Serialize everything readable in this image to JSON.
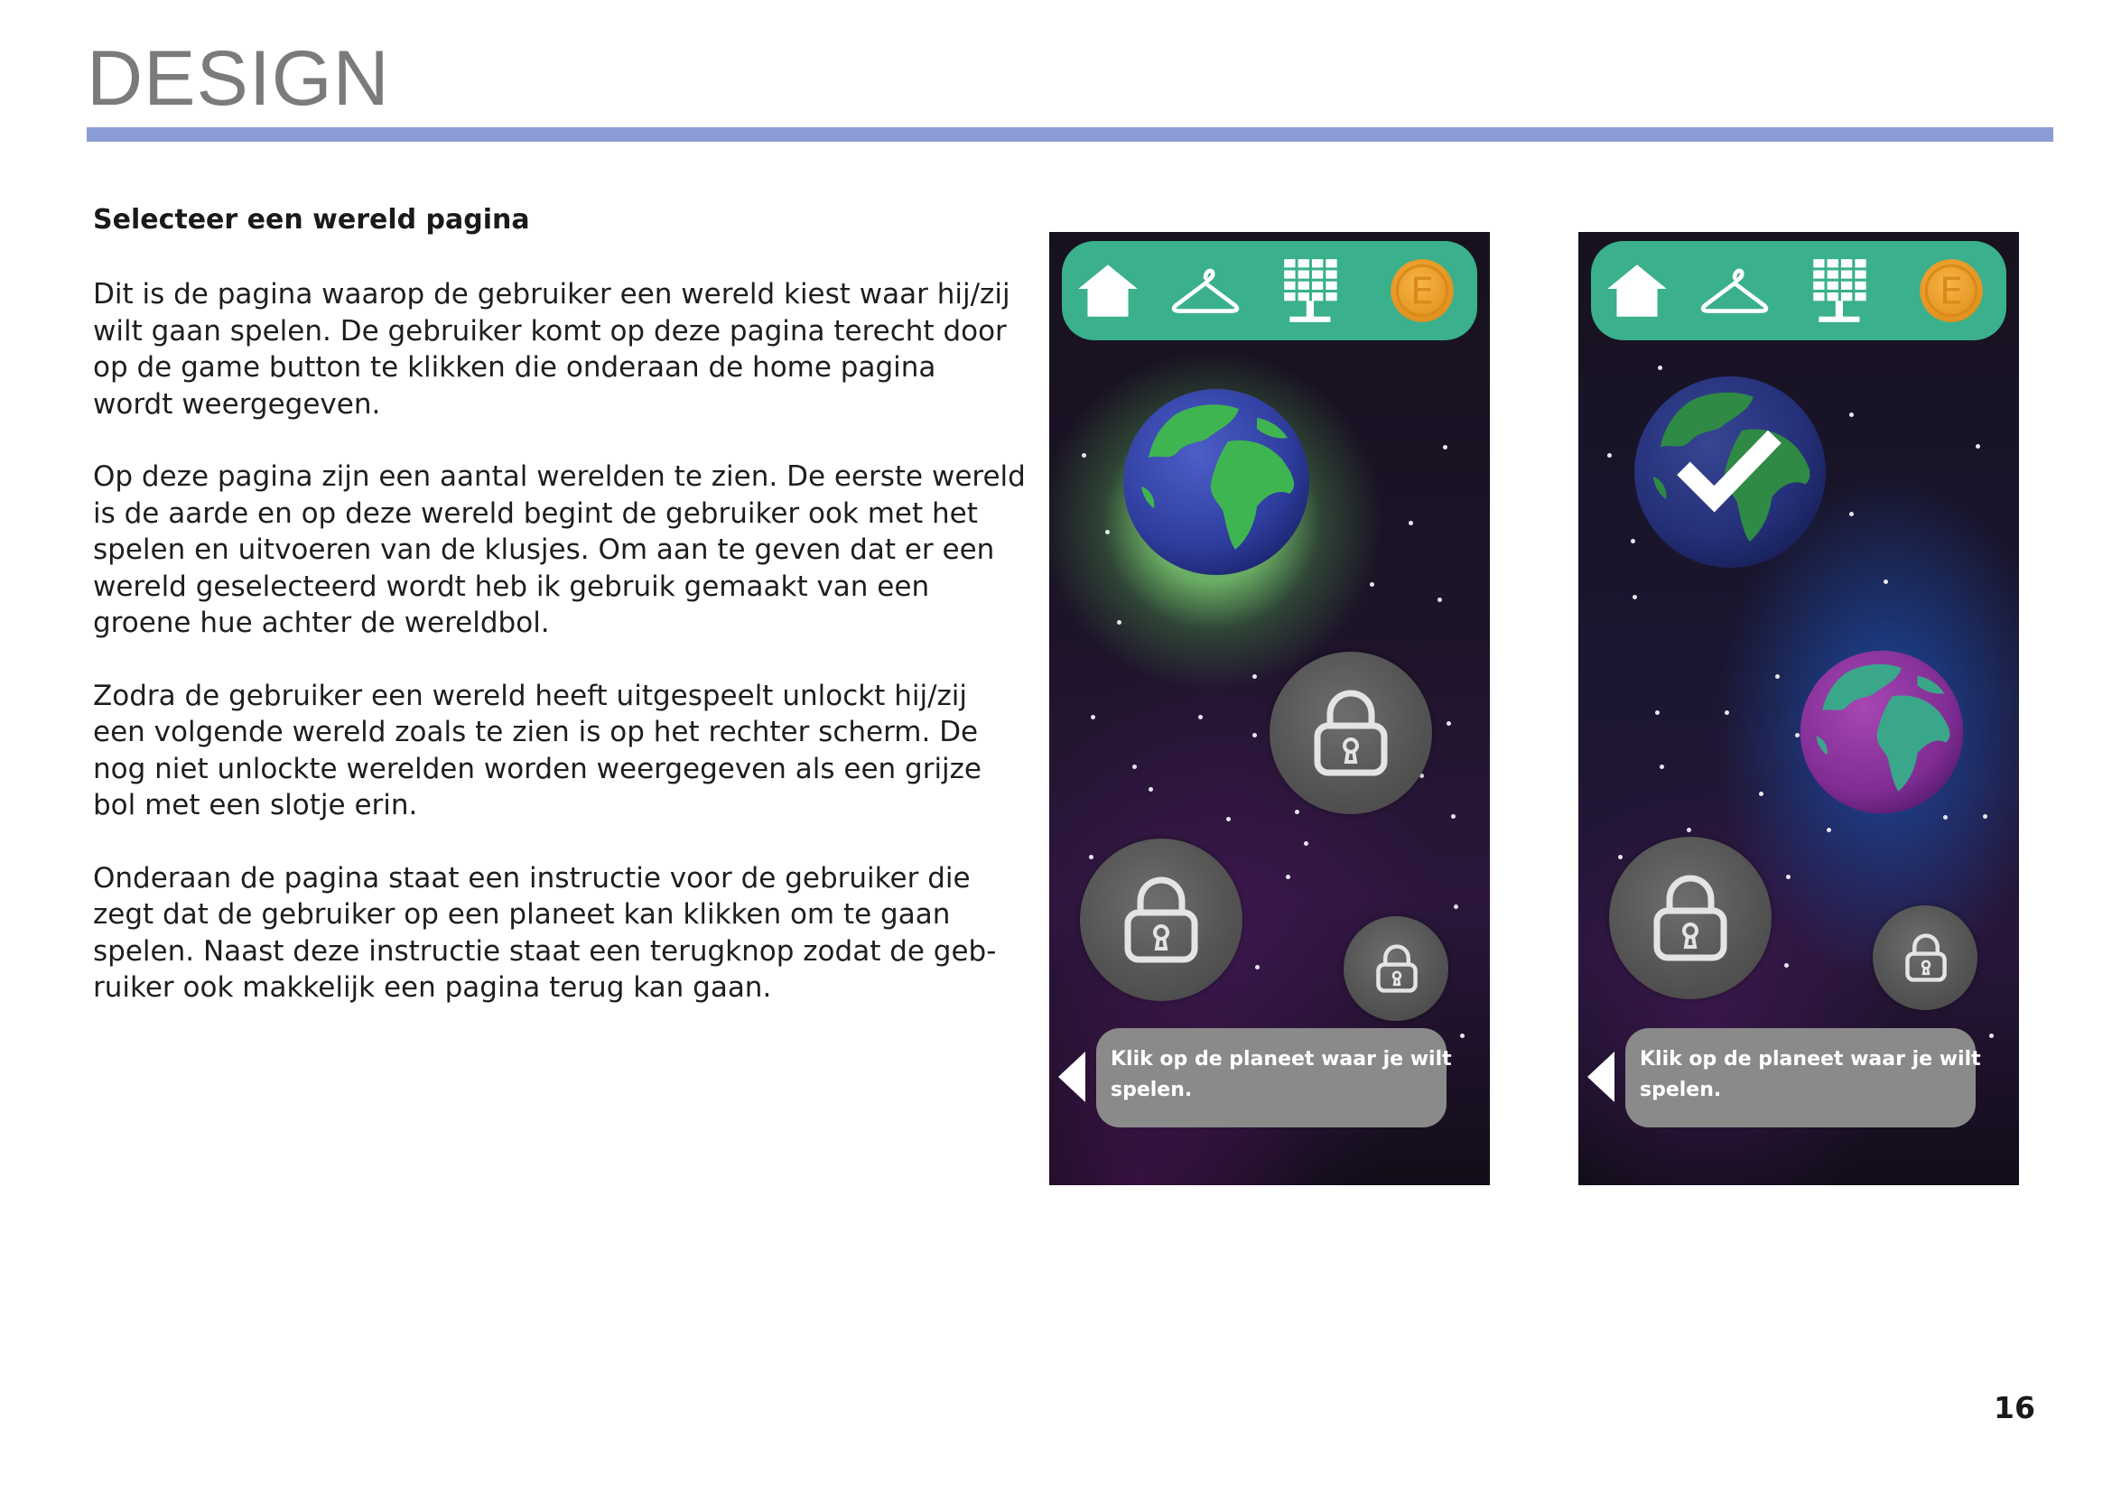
{
  "page": {
    "heading": "DESIGN",
    "subtitle": "Selecteer een wereld pagina",
    "page_number": "16",
    "accent_color": "#8c9cd4"
  },
  "paragraphs": [
    [
      "Dit is de pagina waarop de gebruiker een wereld kiest waar hij/zij",
      "wilt gaan spelen. De gebruiker komt op deze pagina terecht door",
      "op de game button te klikken die onderaan de home pagina",
      "wordt weergegeven."
    ],
    [
      "Op deze pagina zijn een aantal werelden te zien. De eerste wereld",
      "is de aarde en op deze wereld begint de gebruiker ook met het",
      "spelen en uitvoeren van de klusjes. Om aan te geven dat er een",
      "wereld geselecteerd wordt heb ik gebruik gemaakt van een",
      "groene hue achter de wereldbol."
    ],
    [
      "Zodra de gebruiker een wereld heeft uitgespeelt unlockt hij/zij",
      "een volgende wereld zoals te zien is op het rechter scherm. De",
      "nog niet unlockte werelden worden weergegeven als een grijze",
      "bol met een slotje erin."
    ],
    [
      "Onderaan de pagina staat een instructie voor de gebruiker die",
      "zegt dat de gebruiker op een planeet kan klikken om te gaan",
      "spelen. Naast deze instructie staat een terugknop zodat de geb-",
      "ruiker ook makkelijk een pagina terug kan gaan."
    ]
  ],
  "mockups": {
    "navbar_color": "#3ab08c",
    "nav_icons": [
      "home-icon",
      "hanger-icon",
      "solar-panel-icon",
      "coin-icon"
    ],
    "coin_letter": "E",
    "instruction_lines": [
      "Klik op de planeet waar je wilt",
      "spelen."
    ],
    "left_screen": {
      "selected_world": "earth",
      "locked_worlds": 3
    },
    "right_screen": {
      "completed_world": "earth",
      "unlocked_world": "purple-planet",
      "locked_worlds": 2
    }
  }
}
